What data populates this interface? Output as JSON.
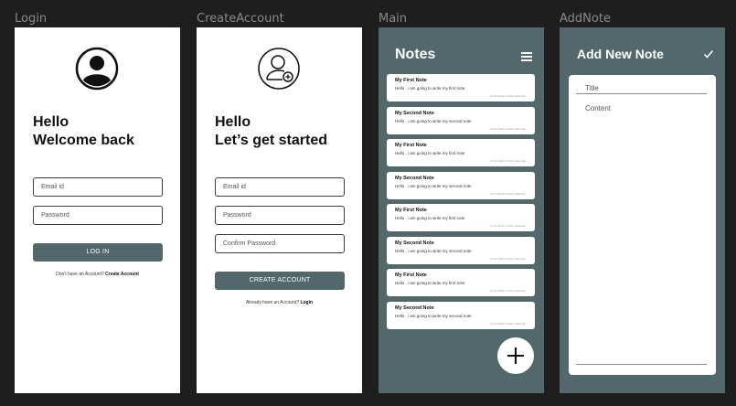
{
  "frames": {
    "login": {
      "label": "Login",
      "greeting_line1": "Hello",
      "greeting_line2": "Welcome back",
      "email_placeholder": "Email id",
      "password_placeholder": "Password",
      "button_label": "LOG IN",
      "footer_prefix": "Don't have an Account?",
      "footer_link": "Create Account"
    },
    "create_account": {
      "label": "CreateAccount",
      "greeting_line1": "Hello",
      "greeting_line2": "Let’s get started",
      "email_placeholder": "Email id",
      "password_placeholder": "Password",
      "confirm_placeholder": "Confirm Password",
      "button_label": "CREATE ACCOUNT",
      "footer_prefix": "Already have an Account?",
      "footer_link": "Login"
    },
    "main": {
      "label": "Main",
      "title": "Notes",
      "notes": [
        {
          "title": "My First Note",
          "body": "Hello , i am going to write my first note",
          "time": "17-02-2024 1:07pm Saturday"
        },
        {
          "title": "My Second Note",
          "body": "Hello , i am going to write my second note",
          "time": "17-02-2024 1:40pm Saturday"
        },
        {
          "title": "My First Note",
          "body": "Hello , i am going to write my first note",
          "time": "17-02-2024 1:07pm Saturday"
        },
        {
          "title": "My Second Note",
          "body": "Hello , i am going to write my second note",
          "time": "17-02-2024 1:40pm Saturday"
        },
        {
          "title": "My First Note",
          "body": "Hello , i am going to write my first note",
          "time": "17-02-2024 1:07pm Saturday"
        },
        {
          "title": "My Second Note",
          "body": "Hello , i am going to write my second note",
          "time": "17-02-2024 1:40pm Saturday"
        },
        {
          "title": "My First Note",
          "body": "Hello , i am going to write my first note",
          "time": "17-02-2024 1:07pm Saturday"
        },
        {
          "title": "My Second Note",
          "body": "Hello , i am going to write my second note",
          "time": "17-02-2024 1:40pm Saturday"
        }
      ]
    },
    "add_note": {
      "label": "AddNote",
      "title": "Add New Note",
      "title_placeholder": "Title",
      "content_placeholder": "Content"
    }
  },
  "colors": {
    "accent": "#52686a",
    "background": "#1e1e1e",
    "card": "#ffffff"
  }
}
